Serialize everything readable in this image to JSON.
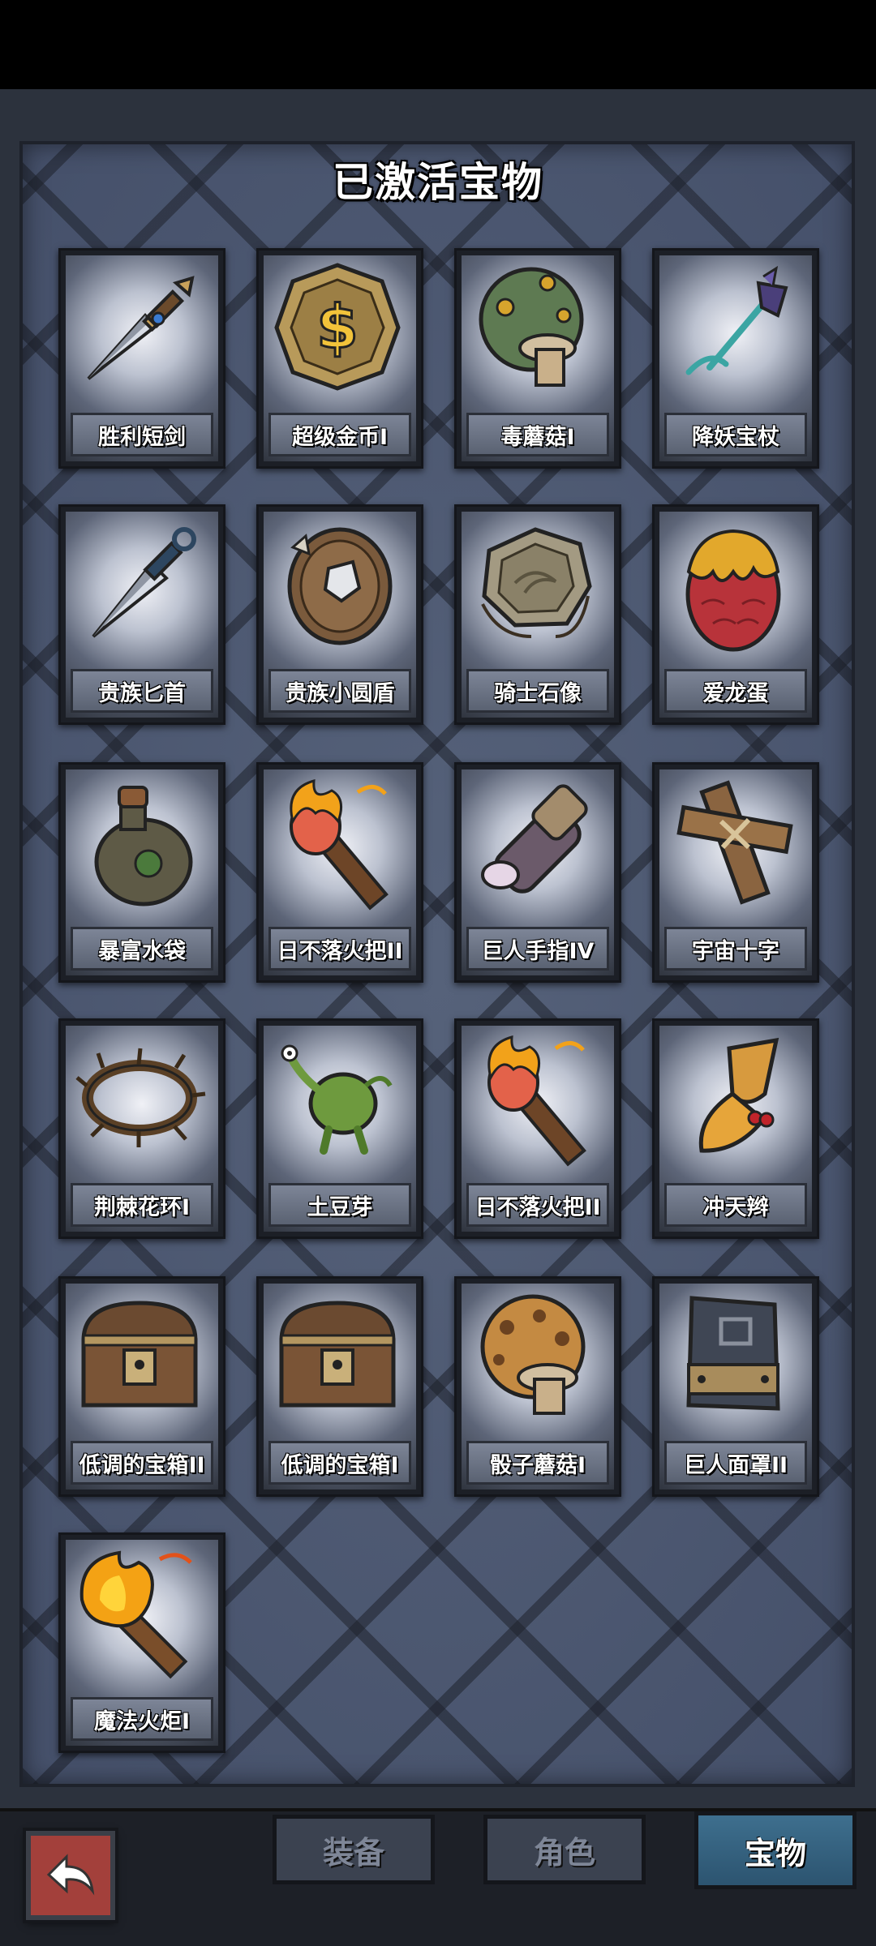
{
  "title": "已激活宝物",
  "treasures": [
    {
      "label": "胜利短剑",
      "icon": "dagger-icon"
    },
    {
      "label": "超级金币I",
      "icon": "gold-coin-icon"
    },
    {
      "label": "毒蘑菇I",
      "icon": "poison-mushroom-icon"
    },
    {
      "label": "降妖宝杖",
      "icon": "staff-icon"
    },
    {
      "label": "贵族匕首",
      "icon": "kunai-icon"
    },
    {
      "label": "贵族小圆盾",
      "icon": "round-shield-icon"
    },
    {
      "label": "骑士石像",
      "icon": "stone-plate-icon"
    },
    {
      "label": "爱龙蛋",
      "icon": "dragon-egg-icon"
    },
    {
      "label": "暴富水袋",
      "icon": "water-flask-icon"
    },
    {
      "label": "日不落火把II",
      "icon": "torch-icon"
    },
    {
      "label": "巨人手指IV",
      "icon": "giant-finger-icon"
    },
    {
      "label": "宇宙十字",
      "icon": "wooden-cross-icon"
    },
    {
      "label": "荆棘花环I",
      "icon": "thorn-wreath-icon"
    },
    {
      "label": "土豆芽",
      "icon": "potato-sprout-icon"
    },
    {
      "label": "日不落火把II",
      "icon": "torch-icon"
    },
    {
      "label": "冲天辫",
      "icon": "pigtail-icon"
    },
    {
      "label": "低调的宝箱II",
      "icon": "treasure-chest-icon"
    },
    {
      "label": "低调的宝箱I",
      "icon": "treasure-chest-icon"
    },
    {
      "label": "骰子蘑菇I",
      "icon": "dice-mushroom-icon"
    },
    {
      "label": "巨人面罩II",
      "icon": "giant-mask-icon"
    },
    {
      "label": "魔法火炬I",
      "icon": "magic-torch-icon"
    }
  ],
  "tabs": [
    {
      "label": "装备"
    },
    {
      "label": "角色"
    },
    {
      "label": "宝物"
    }
  ],
  "back_icon": "back-arrow-icon"
}
